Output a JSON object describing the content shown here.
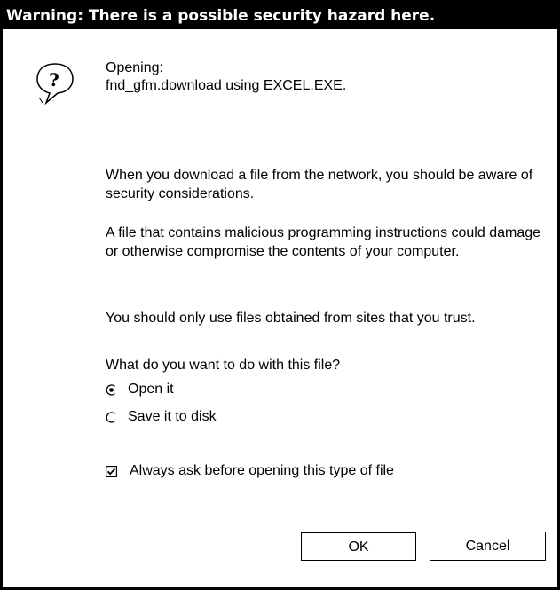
{
  "dialog": {
    "title": "Warning:  There is a possible security hazard here.",
    "opening_label": "Opening:",
    "opening_file": "fnd_gfm.download using EXCEL.EXE.",
    "icon": "help-question-icon",
    "paragraphs": [
      "When you download a file from the network, you should be aware of security considerations.",
      "A file that contains malicious programming instructions could damage or otherwise compromise the contents of your computer.",
      "You should only use files obtained from sites that you trust.",
      "What do you want to do with this file?"
    ],
    "options": [
      {
        "label": "Open it",
        "selected": true
      },
      {
        "label": "Save it to disk",
        "selected": false
      }
    ],
    "always_ask": {
      "label": "Always ask before opening this type of file",
      "checked": true
    },
    "buttons": {
      "ok": "OK",
      "cancel": "Cancel"
    }
  }
}
